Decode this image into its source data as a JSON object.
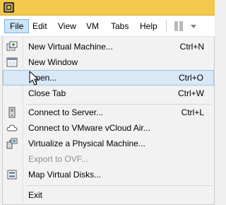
{
  "menubar": {
    "items": [
      "File",
      "Edit",
      "View",
      "VM",
      "Tabs",
      "Help"
    ],
    "active": "File"
  },
  "file_menu": {
    "items": [
      {
        "label": "New Virtual Machine...",
        "shortcut": "Ctrl+N",
        "icon": "new-vm-icon"
      },
      {
        "label": "New Window",
        "shortcut": "",
        "icon": "new-window-icon"
      },
      {
        "label": "Open...",
        "shortcut": "Ctrl+O",
        "icon": "",
        "hovered": true
      },
      {
        "label": "Close Tab",
        "shortcut": "Ctrl+W",
        "icon": ""
      },
      {
        "label": "Connect to Server...",
        "shortcut": "Ctrl+L",
        "icon": "server-icon"
      },
      {
        "label": "Connect to VMware vCloud Air...",
        "shortcut": "",
        "icon": "cloud-icon"
      },
      {
        "label": "Virtualize a Physical Machine...",
        "shortcut": "",
        "icon": "physical-machine-icon"
      },
      {
        "label": "Export to OVF...",
        "shortcut": "",
        "icon": "",
        "disabled": true
      },
      {
        "label": "Map Virtual Disks...",
        "shortcut": "",
        "icon": "map-disk-icon"
      },
      {
        "label": "Exit",
        "shortcut": "",
        "icon": ""
      }
    ]
  },
  "colors": {
    "titlebar": "#f2c94c",
    "highlight": "#d8e8f6",
    "active_menu": "#cce4f7"
  }
}
